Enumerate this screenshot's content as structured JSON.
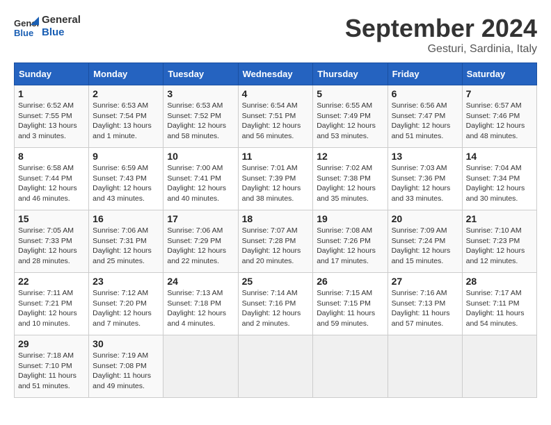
{
  "header": {
    "logo_line1": "General",
    "logo_line2": "Blue",
    "month": "September 2024",
    "location": "Gesturi, Sardinia, Italy"
  },
  "columns": [
    "Sunday",
    "Monday",
    "Tuesday",
    "Wednesday",
    "Thursday",
    "Friday",
    "Saturday"
  ],
  "weeks": [
    [
      {
        "day": "1",
        "info": "Sunrise: 6:52 AM\nSunset: 7:55 PM\nDaylight: 13 hours\nand 3 minutes."
      },
      {
        "day": "2",
        "info": "Sunrise: 6:53 AM\nSunset: 7:54 PM\nDaylight: 13 hours\nand 1 minute."
      },
      {
        "day": "3",
        "info": "Sunrise: 6:53 AM\nSunset: 7:52 PM\nDaylight: 12 hours\nand 58 minutes."
      },
      {
        "day": "4",
        "info": "Sunrise: 6:54 AM\nSunset: 7:51 PM\nDaylight: 12 hours\nand 56 minutes."
      },
      {
        "day": "5",
        "info": "Sunrise: 6:55 AM\nSunset: 7:49 PM\nDaylight: 12 hours\nand 53 minutes."
      },
      {
        "day": "6",
        "info": "Sunrise: 6:56 AM\nSunset: 7:47 PM\nDaylight: 12 hours\nand 51 minutes."
      },
      {
        "day": "7",
        "info": "Sunrise: 6:57 AM\nSunset: 7:46 PM\nDaylight: 12 hours\nand 48 minutes."
      }
    ],
    [
      {
        "day": "8",
        "info": "Sunrise: 6:58 AM\nSunset: 7:44 PM\nDaylight: 12 hours\nand 46 minutes."
      },
      {
        "day": "9",
        "info": "Sunrise: 6:59 AM\nSunset: 7:43 PM\nDaylight: 12 hours\nand 43 minutes."
      },
      {
        "day": "10",
        "info": "Sunrise: 7:00 AM\nSunset: 7:41 PM\nDaylight: 12 hours\nand 40 minutes."
      },
      {
        "day": "11",
        "info": "Sunrise: 7:01 AM\nSunset: 7:39 PM\nDaylight: 12 hours\nand 38 minutes."
      },
      {
        "day": "12",
        "info": "Sunrise: 7:02 AM\nSunset: 7:38 PM\nDaylight: 12 hours\nand 35 minutes."
      },
      {
        "day": "13",
        "info": "Sunrise: 7:03 AM\nSunset: 7:36 PM\nDaylight: 12 hours\nand 33 minutes."
      },
      {
        "day": "14",
        "info": "Sunrise: 7:04 AM\nSunset: 7:34 PM\nDaylight: 12 hours\nand 30 minutes."
      }
    ],
    [
      {
        "day": "15",
        "info": "Sunrise: 7:05 AM\nSunset: 7:33 PM\nDaylight: 12 hours\nand 28 minutes."
      },
      {
        "day": "16",
        "info": "Sunrise: 7:06 AM\nSunset: 7:31 PM\nDaylight: 12 hours\nand 25 minutes."
      },
      {
        "day": "17",
        "info": "Sunrise: 7:06 AM\nSunset: 7:29 PM\nDaylight: 12 hours\nand 22 minutes."
      },
      {
        "day": "18",
        "info": "Sunrise: 7:07 AM\nSunset: 7:28 PM\nDaylight: 12 hours\nand 20 minutes."
      },
      {
        "day": "19",
        "info": "Sunrise: 7:08 AM\nSunset: 7:26 PM\nDaylight: 12 hours\nand 17 minutes."
      },
      {
        "day": "20",
        "info": "Sunrise: 7:09 AM\nSunset: 7:24 PM\nDaylight: 12 hours\nand 15 minutes."
      },
      {
        "day": "21",
        "info": "Sunrise: 7:10 AM\nSunset: 7:23 PM\nDaylight: 12 hours\nand 12 minutes."
      }
    ],
    [
      {
        "day": "22",
        "info": "Sunrise: 7:11 AM\nSunset: 7:21 PM\nDaylight: 12 hours\nand 10 minutes."
      },
      {
        "day": "23",
        "info": "Sunrise: 7:12 AM\nSunset: 7:20 PM\nDaylight: 12 hours\nand 7 minutes."
      },
      {
        "day": "24",
        "info": "Sunrise: 7:13 AM\nSunset: 7:18 PM\nDaylight: 12 hours\nand 4 minutes."
      },
      {
        "day": "25",
        "info": "Sunrise: 7:14 AM\nSunset: 7:16 PM\nDaylight: 12 hours\nand 2 minutes."
      },
      {
        "day": "26",
        "info": "Sunrise: 7:15 AM\nSunset: 7:15 PM\nDaylight: 11 hours\nand 59 minutes."
      },
      {
        "day": "27",
        "info": "Sunrise: 7:16 AM\nSunset: 7:13 PM\nDaylight: 11 hours\nand 57 minutes."
      },
      {
        "day": "28",
        "info": "Sunrise: 7:17 AM\nSunset: 7:11 PM\nDaylight: 11 hours\nand 54 minutes."
      }
    ],
    [
      {
        "day": "29",
        "info": "Sunrise: 7:18 AM\nSunset: 7:10 PM\nDaylight: 11 hours\nand 51 minutes."
      },
      {
        "day": "30",
        "info": "Sunrise: 7:19 AM\nSunset: 7:08 PM\nDaylight: 11 hours\nand 49 minutes."
      },
      {
        "day": "",
        "info": ""
      },
      {
        "day": "",
        "info": ""
      },
      {
        "day": "",
        "info": ""
      },
      {
        "day": "",
        "info": ""
      },
      {
        "day": "",
        "info": ""
      }
    ]
  ]
}
